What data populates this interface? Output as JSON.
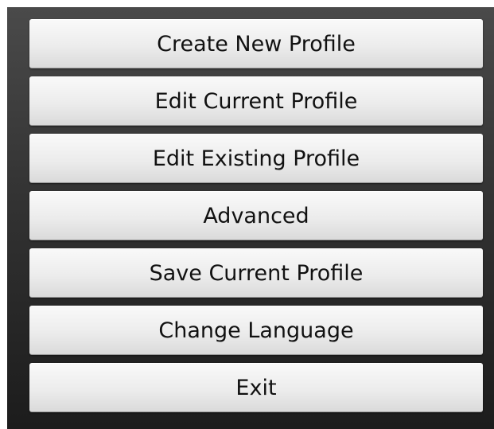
{
  "menu": {
    "buttons": [
      {
        "label": "Create New Profile"
      },
      {
        "label": "Edit Current Profile"
      },
      {
        "label": "Edit Existing Profile"
      },
      {
        "label": "Advanced"
      },
      {
        "label": "Save Current Profile"
      },
      {
        "label": "Change Language"
      },
      {
        "label": "Exit"
      }
    ]
  },
  "colors": {
    "panel_top": "#4a4a4a",
    "panel_bottom": "#1c1c1c",
    "button_face": "#ececec",
    "button_text": "#111111"
  }
}
